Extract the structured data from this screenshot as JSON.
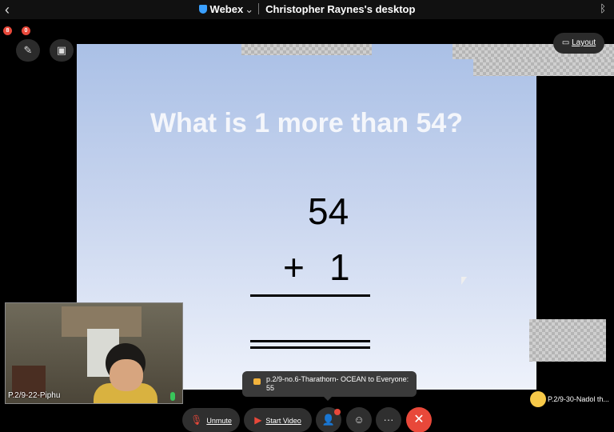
{
  "topbar": {
    "back_icon": "chevron-left-icon",
    "app_name": "Webex",
    "session_title": "Christopher Raynes's desktop",
    "bluetooth_icon": "bluetooth-icon"
  },
  "indicators": {
    "rec1": "8",
    "rec2": "0"
  },
  "toolbar_left": {
    "annotate_icon": "pen-icon",
    "share_icon": "screen-icon"
  },
  "layout": {
    "label": "Layout",
    "icon": "layout-icon"
  },
  "slide": {
    "question": "What is 1 more than 54?",
    "addend1": "54",
    "operator": "+",
    "addend2": "1"
  },
  "self_view": {
    "name": "P.2/9-22-Piphu",
    "mic_status": "on"
  },
  "chat_notification": {
    "sender_line": "p.2/9-no.6-Tharathorn- OCEAN to Everyone:",
    "message": "55"
  },
  "other_participant": {
    "name": "P.2/9-30-Nadol th..."
  },
  "controls": {
    "unmute_label": "Unmute",
    "start_video_label": "Start Video",
    "participants_icon": "participants-icon",
    "reactions_icon": "smile-icon",
    "more_icon": "more-icon",
    "end_icon": "close-icon"
  },
  "colors": {
    "accent_red": "#e8483a",
    "webex_blue": "#3aa0ff",
    "mic_green": "#39c45a"
  }
}
